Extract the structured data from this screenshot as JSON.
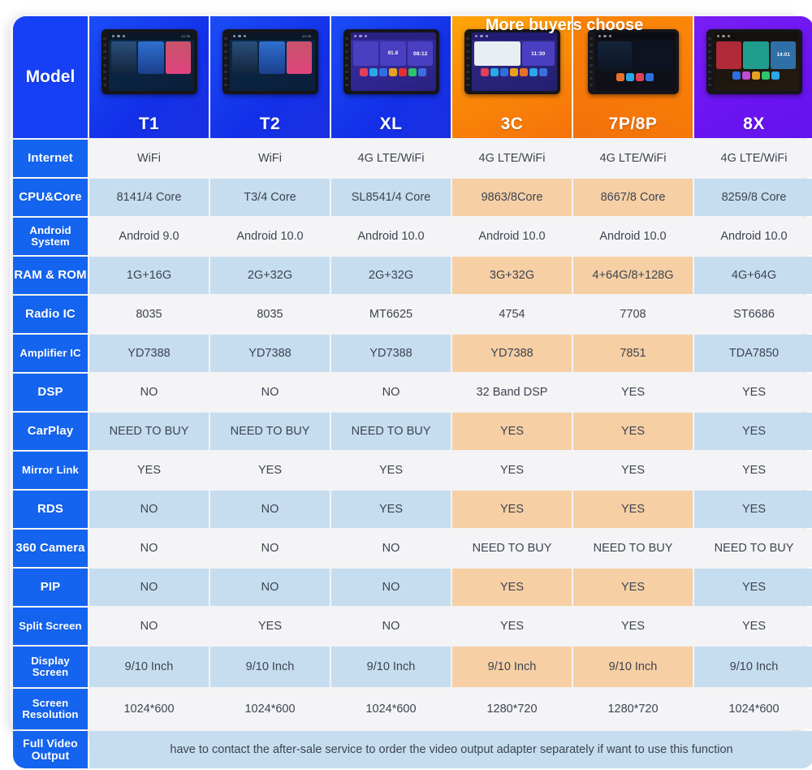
{
  "promo": {
    "banner": "More buyers choose"
  },
  "header": {
    "label": "Model",
    "products": [
      {
        "name": "T1",
        "theme": "blue"
      },
      {
        "name": "T2",
        "theme": "blue"
      },
      {
        "name": "XL",
        "theme": "blue"
      },
      {
        "name": "3C",
        "theme": "orange"
      },
      {
        "name": "7P/8P",
        "theme": "orange"
      },
      {
        "name": "8X",
        "theme": "purple"
      }
    ]
  },
  "device_screens": {
    "t1_time": "10:35",
    "t2_time": "10:35",
    "xl_clock": "08:12",
    "xl_radio": "91.8",
    "c3_clock": "11:30",
    "x8_clock": "14:01"
  },
  "rows": [
    {
      "label": "Internet",
      "label_lines": [
        "Internet"
      ],
      "values": [
        "WiFi",
        "WiFi",
        "4G LTE/WiFi",
        "4G LTE/WiFi",
        "4G LTE/WiFi",
        "4G LTE/WiFi"
      ]
    },
    {
      "label": "CPU&Core",
      "label_lines": [
        "CPU&Core"
      ],
      "values": [
        "8141/4 Core",
        "T3/4 Core",
        "SL8541/4 Core",
        "9863/8Core",
        "8667/8 Core",
        "8259/8 Core"
      ]
    },
    {
      "label": "Android System",
      "label_lines": [
        "Android",
        "System"
      ],
      "values": [
        "Android 9.0",
        "Android 10.0",
        "Android 10.0",
        "Android 10.0",
        "Android 10.0",
        "Android 10.0"
      ]
    },
    {
      "label": "RAM & ROM",
      "label_lines": [
        "RAM & ROM"
      ],
      "values": [
        "1G+16G",
        "2G+32G",
        "2G+32G",
        "3G+32G",
        "4+64G/8+128G",
        "4G+64G"
      ]
    },
    {
      "label": "Radio IC",
      "label_lines": [
        "Radio IC"
      ],
      "values": [
        "8035",
        "8035",
        "MT6625",
        "4754",
        "7708",
        "ST6686"
      ]
    },
    {
      "label": "Amplifier IC",
      "label_lines": [
        "Amplifier IC"
      ],
      "values": [
        "YD7388",
        "YD7388",
        "YD7388",
        "YD7388",
        "7851",
        "TDA7850"
      ]
    },
    {
      "label": "DSP",
      "label_lines": [
        "DSP"
      ],
      "values": [
        "NO",
        "NO",
        "NO",
        "32 Band DSP",
        "YES",
        "YES"
      ]
    },
    {
      "label": "CarPlay",
      "label_lines": [
        "CarPlay"
      ],
      "values": [
        "NEED TO BUY",
        "NEED TO BUY",
        "NEED TO BUY",
        "YES",
        "YES",
        "YES"
      ]
    },
    {
      "label": "Mirror Link",
      "label_lines": [
        "Mirror Link"
      ],
      "values": [
        "YES",
        "YES",
        "YES",
        "YES",
        "YES",
        "YES"
      ]
    },
    {
      "label": "RDS",
      "label_lines": [
        "RDS"
      ],
      "values": [
        "NO",
        "NO",
        "YES",
        "YES",
        "YES",
        "YES"
      ]
    },
    {
      "label": "360 Camera",
      "label_lines": [
        "360 Camera"
      ],
      "values": [
        "NO",
        "NO",
        "NO",
        "NEED TO BUY",
        "NEED TO BUY",
        "NEED TO BUY"
      ]
    },
    {
      "label": "PIP",
      "label_lines": [
        "PIP"
      ],
      "values": [
        "NO",
        "NO",
        "NO",
        "YES",
        "YES",
        "YES"
      ]
    },
    {
      "label": "Split Screen",
      "label_lines": [
        "Split Screen"
      ],
      "values": [
        "NO",
        "YES",
        "NO",
        "YES",
        "YES",
        "YES"
      ]
    },
    {
      "label": "Display Screen",
      "label_lines": [
        "Display",
        "Screen"
      ],
      "values": [
        "9/10 Inch",
        "9/10 Inch",
        "9/10 Inch",
        "9/10 Inch",
        "9/10 Inch",
        "9/10 Inch"
      ]
    },
    {
      "label": "Screen Resolution",
      "label_lines": [
        "Screen",
        "Resolution"
      ],
      "values": [
        "1024*600",
        "1024*600",
        "1024*600",
        "1280*720",
        "1280*720",
        "1024*600"
      ]
    }
  ],
  "footer": {
    "label_lines": [
      "Full Video",
      "Output"
    ],
    "note": "have to contact the after-sale service to order the video output adapter separately if want to use this function"
  },
  "colors": {
    "label_blue": "#1464f0",
    "header_blue": "#1640f5",
    "header_orange": "#f6830a",
    "header_purple": "#6c15f2",
    "tint_blue": "#c6ddf0",
    "tint_orange": "#f6cfa4",
    "cell_plain": "#f4f4f6"
  }
}
